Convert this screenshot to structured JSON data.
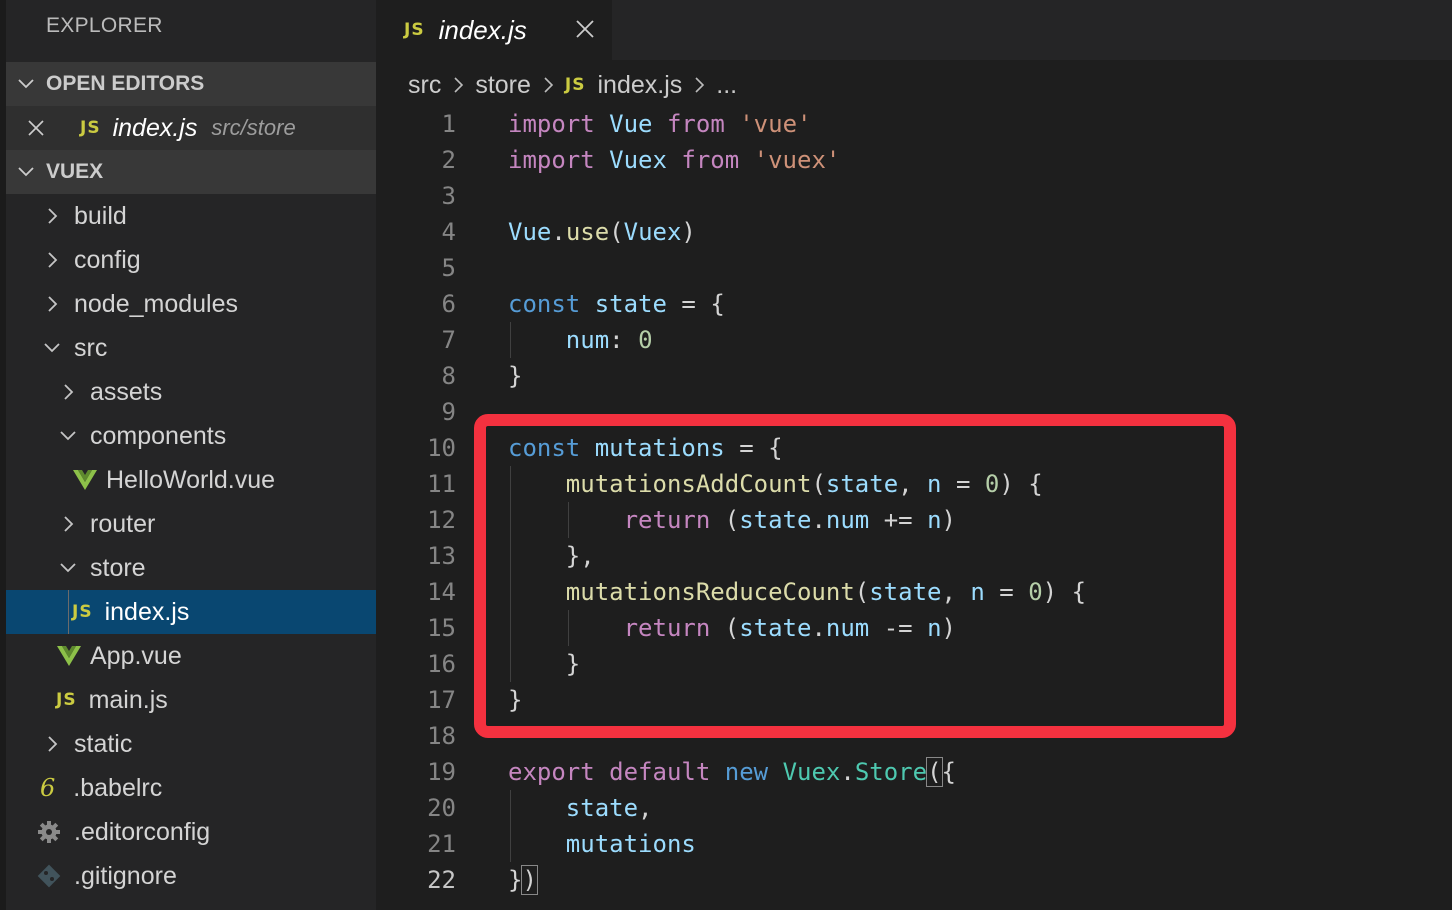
{
  "sidebar": {
    "title": "EXPLORER",
    "open_editors": {
      "header": "OPEN EDITORS",
      "items": [
        {
          "icon": "js",
          "name": "index.js",
          "path": "src/store"
        }
      ]
    },
    "project": {
      "header": "VUEX",
      "items": [
        {
          "label": "build",
          "type": "folder",
          "expanded": false
        },
        {
          "label": "config",
          "type": "folder",
          "expanded": false
        },
        {
          "label": "node_modules",
          "type": "folder",
          "expanded": false
        },
        {
          "label": "src",
          "type": "folder",
          "expanded": true
        },
        {
          "label": "assets",
          "type": "folder",
          "expanded": false
        },
        {
          "label": "components",
          "type": "folder",
          "expanded": true
        },
        {
          "label": "HelloWorld.vue",
          "type": "vue"
        },
        {
          "label": "router",
          "type": "folder",
          "expanded": false
        },
        {
          "label": "store",
          "type": "folder",
          "expanded": true
        },
        {
          "label": "index.js",
          "type": "js",
          "selected": true
        },
        {
          "label": "App.vue",
          "type": "vue"
        },
        {
          "label": "main.js",
          "type": "js"
        },
        {
          "label": "static",
          "type": "folder",
          "expanded": false
        },
        {
          "label": ".babelrc",
          "type": "babel"
        },
        {
          "label": ".editorconfig",
          "type": "gear"
        },
        {
          "label": ".gitignore",
          "type": "git"
        }
      ]
    }
  },
  "editor": {
    "tab": {
      "icon_label": "JS",
      "title": "index.js"
    },
    "breadcrumb": {
      "parts": [
        "src",
        "store",
        "index.js",
        "..."
      ]
    },
    "active_line": 22,
    "lines": [
      {
        "n": "1",
        "text": "import Vue from 'vue'"
      },
      {
        "n": "2",
        "text": "import Vuex from 'vuex'"
      },
      {
        "n": "3",
        "text": ""
      },
      {
        "n": "4",
        "text": "Vue.use(Vuex)"
      },
      {
        "n": "5",
        "text": ""
      },
      {
        "n": "6",
        "text": "const state = {"
      },
      {
        "n": "7",
        "text": "    num: 0"
      },
      {
        "n": "8",
        "text": "}"
      },
      {
        "n": "9",
        "text": ""
      },
      {
        "n": "10",
        "text": "const mutations = {"
      },
      {
        "n": "11",
        "text": "    mutationsAddCount(state, n = 0) {"
      },
      {
        "n": "12",
        "text": "        return (state.num += n)"
      },
      {
        "n": "13",
        "text": "    },"
      },
      {
        "n": "14",
        "text": "    mutationsReduceCount(state, n = 0) {"
      },
      {
        "n": "15",
        "text": "        return (state.num -= n)"
      },
      {
        "n": "16",
        "text": "    }"
      },
      {
        "n": "17",
        "text": "}"
      },
      {
        "n": "18",
        "text": ""
      },
      {
        "n": "19",
        "text": "export default new Vuex.Store({"
      },
      {
        "n": "20",
        "text": "    state,"
      },
      {
        "n": "21",
        "text": "    mutations"
      },
      {
        "n": "22",
        "text": "})"
      }
    ],
    "colors": {
      "keyword": "#c586c0",
      "storage": "#569cd6",
      "variable": "#9cdcfe",
      "string": "#ce9178",
      "function": "#dcdcaa",
      "class": "#4ec9b0",
      "number": "#b5cea8",
      "highlight_box": "#f4313f",
      "selection": "#094771"
    }
  }
}
